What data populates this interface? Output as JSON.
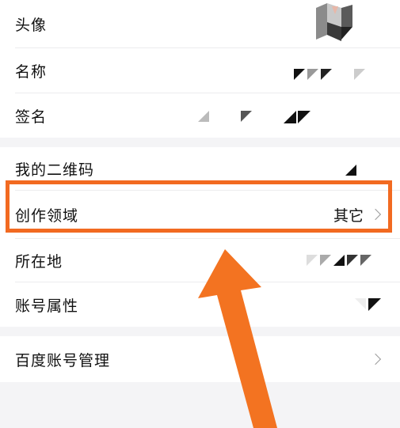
{
  "rows": {
    "avatar": {
      "label": "头像"
    },
    "name": {
      "label": "名称"
    },
    "signature": {
      "label": "签名"
    },
    "qrcode": {
      "label": "我的二维码"
    },
    "domain": {
      "label": "创作领域",
      "value": "其它"
    },
    "location": {
      "label": "所在地"
    },
    "account_attr": {
      "label": "账号属性"
    },
    "baidu_account": {
      "label": "百度账号管理"
    }
  },
  "colors": {
    "highlight": "#f26a21",
    "arrow": "#f37321",
    "background": "#f4f4f6"
  }
}
